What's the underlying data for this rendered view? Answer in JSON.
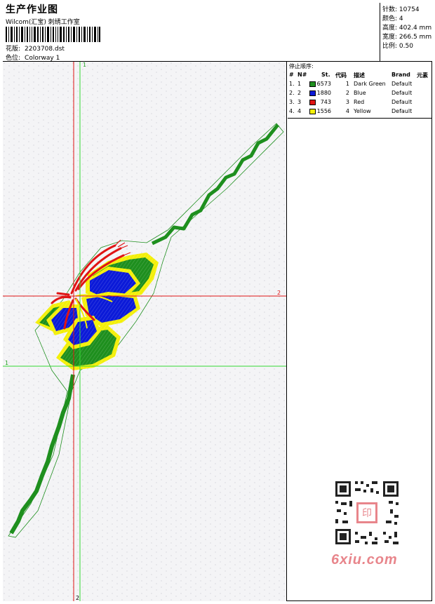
{
  "header": {
    "title": "生产作业图",
    "company": "Wilcom(汇宝) 刺绣工作室",
    "design_label": "花版:",
    "design_file": "2203708.dst",
    "colorway_label": "色位:",
    "colorway_value": "Colorway 1"
  },
  "stats": [
    {
      "label": "针数:",
      "value": "10754"
    },
    {
      "label": "颜色:",
      "value": "4"
    },
    {
      "label": "高度:",
      "value": "402.4 mm"
    },
    {
      "label": "宽度:",
      "value": "266.5 mm"
    },
    {
      "label": "比例:",
      "value": "0.50"
    }
  ],
  "plot": {
    "axis_v1_label": "1",
    "axis_h2_label": "2",
    "axis_h1_label": "1",
    "axis_v2_label": "2",
    "colors": {
      "green": "#1e8f1e",
      "blue": "#0b1ad8",
      "red": "#e01414",
      "yellow": "#f3ef08",
      "guide_green": "#33d933",
      "guide_red": "#e01414"
    }
  },
  "stop_sequence": {
    "title": "停止顺序:",
    "columns": {
      "num": "#",
      "no": "N#",
      "st": "St.",
      "code": "代码",
      "desc": "描述",
      "brand": "Brand",
      "element": "元素"
    },
    "rows": [
      {
        "num": "1.",
        "no": "1",
        "color": "#1e8f1e",
        "st": "6573",
        "code": "1",
        "desc": "Dark Green",
        "brand": "Default"
      },
      {
        "num": "2.",
        "no": "2",
        "color": "#0b1ad8",
        "st": "1880",
        "code": "2",
        "desc": "Blue",
        "brand": "Default"
      },
      {
        "num": "3.",
        "no": "3",
        "color": "#e01414",
        "st": "743",
        "code": "3",
        "desc": "Red",
        "brand": "Default"
      },
      {
        "num": "4.",
        "no": "4",
        "color": "#f3ef08",
        "st": "1556",
        "code": "4",
        "desc": "Yellow",
        "brand": "Default"
      }
    ]
  },
  "watermark": {
    "text": "6xiu.com",
    "qr_badge": "印",
    "color": "#e8858b"
  }
}
